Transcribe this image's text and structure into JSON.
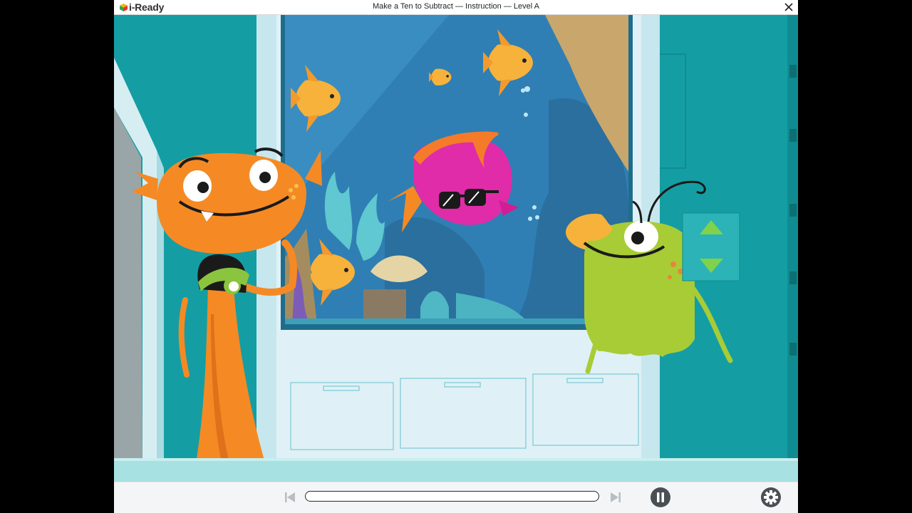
{
  "app": {
    "brand": "i-Ready",
    "window_title": "Make a Ten to Subtract — Instruction — Level A"
  },
  "scene": {
    "description_icon": "animated-lesson-scene"
  },
  "controls": {
    "progress_fraction": 0.0,
    "prev_icon": "skip-previous-icon",
    "next_icon": "skip-next-icon",
    "pause_icon": "pause-icon",
    "settings_icon": "gear-icon"
  },
  "colors": {
    "wall": "#149ea3",
    "tank_water": "#2f7fb4",
    "orange_character": "#f58a24",
    "green_character": "#a8cc35",
    "pink_fish": "#e02ca8"
  }
}
